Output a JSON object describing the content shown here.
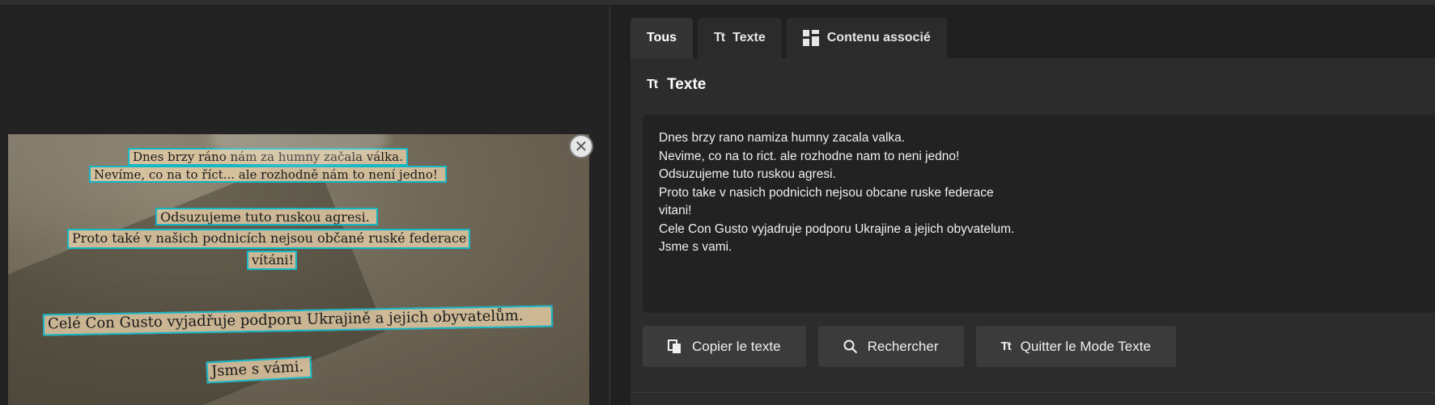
{
  "image_panel": {
    "ocr_lines": [
      "Dnes brzy ráno nám za humny začala válka.",
      "Nevíme, co na to říct... ale rozhodně nám to není jedno!",
      "Odsuzujeme tuto ruskou agresi.",
      "Proto také v našich podnicích nejsou občané ruské federace",
      "vítáni!",
      "Celé Con Gusto vyjadřuje podporu Ukrajině a jejich obyvatelům.",
      "Jsme s vámi."
    ],
    "close_icon": "close-icon"
  },
  "tabs": [
    {
      "label": "Tous",
      "icon": ""
    },
    {
      "label": "Texte",
      "icon": "Tt"
    },
    {
      "label": "Contenu associé",
      "icon": "grid-icon"
    }
  ],
  "panel": {
    "icon": "Tt",
    "title": "Texte",
    "text_lines": [
      "Dnes brzy rano namiza humny zacala valka.",
      "Nevime, co na to rict. ale rozhodne nam to neni jedno!",
      "Odsuzujeme tuto ruskou agresi.",
      "Proto take v nasich podnicich nejsou obcane ruske federace",
      "vitani!",
      "Cele Con Gusto vyjadruje podporu Ukrajine a jejich obyvatelum.",
      "Jsme s vami."
    ]
  },
  "actions": {
    "copy_label": "Copier le texte",
    "search_label": "Rechercher",
    "quit_label": "Quitter le Mode Texte",
    "quit_icon": "Tt"
  }
}
